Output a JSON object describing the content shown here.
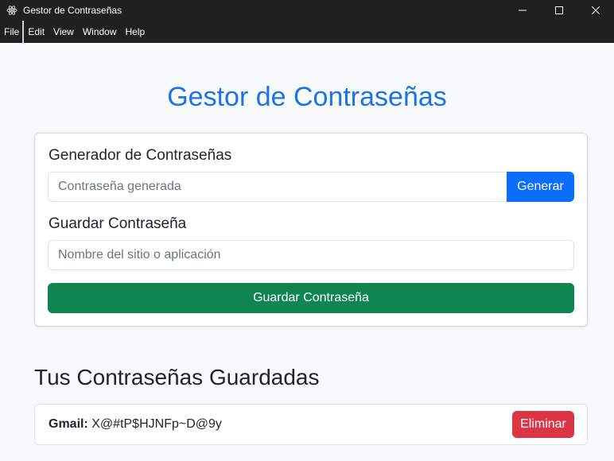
{
  "window": {
    "title": "Gestor de Contraseñas",
    "icon": "electron-atom-icon",
    "controls": [
      "minimize-icon",
      "maximize-icon",
      "close-icon"
    ]
  },
  "menu": {
    "items": [
      "File",
      "Edit",
      "View",
      "Window",
      "Help"
    ]
  },
  "main": {
    "heading": "Gestor de Contraseñas",
    "generator": {
      "title": "Generador de Contraseñas",
      "input_placeholder": "Contraseña generada",
      "input_value": "",
      "button_label": "Generar"
    },
    "save": {
      "title": "Guardar Contraseña",
      "input_placeholder": "Nombre del sitio o aplicación",
      "input_value": "",
      "button_label": "Guardar Contraseña"
    },
    "saved": {
      "heading": "Tus Contraseñas Guardadas",
      "items": [
        {
          "site": "Gmail:",
          "password": "X@#tP$HJNFp~D@9y",
          "delete_label": "Eliminar"
        }
      ]
    }
  },
  "colors": {
    "titlebar": "#202020",
    "heading": "#1a73e8",
    "primary": "#0d6efd",
    "success": "#0f8551",
    "danger": "#dc3545",
    "background": "#f8f9fa"
  }
}
